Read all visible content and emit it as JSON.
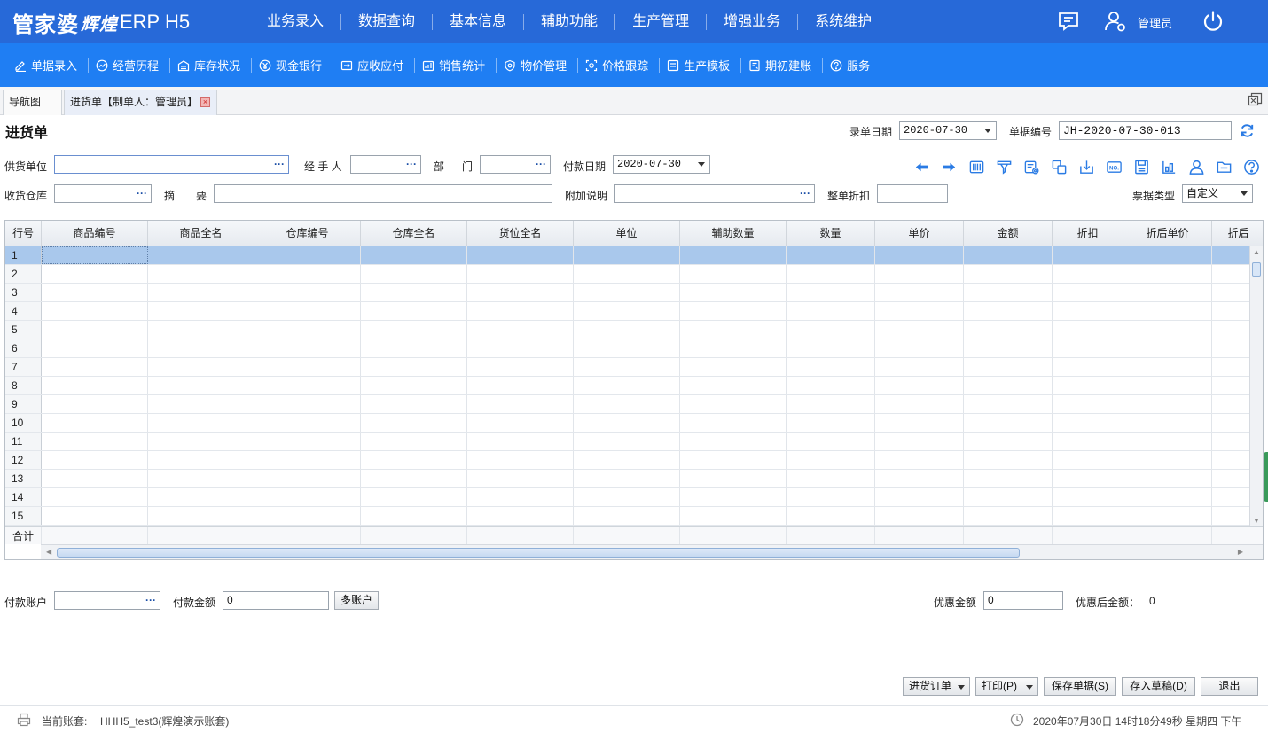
{
  "app": {
    "logo_main": "管家婆",
    "logo_sub": "辉煌",
    "logo_suffix": "ERP H5",
    "user": "管理员"
  },
  "main_menu": [
    "业务录入",
    "数据查询",
    "基本信息",
    "辅助功能",
    "生产管理",
    "增强业务",
    "系统维护"
  ],
  "sub_menu": [
    {
      "label": "单据录入",
      "icon": "edit-icon"
    },
    {
      "label": "经营历程",
      "icon": "chart-circle-icon"
    },
    {
      "label": "库存状况",
      "icon": "warehouse-icon"
    },
    {
      "label": "现金银行",
      "icon": "yuan-icon"
    },
    {
      "label": "应收应付",
      "icon": "receivable-icon"
    },
    {
      "label": "销售统计",
      "icon": "stats-icon"
    },
    {
      "label": "物价管理",
      "icon": "shield-price-icon"
    },
    {
      "label": "价格跟踪",
      "icon": "track-icon"
    },
    {
      "label": "生产模板",
      "icon": "template-icon"
    },
    {
      "label": "期初建账",
      "icon": "ledger-icon"
    },
    {
      "label": "服务",
      "icon": "help-icon"
    }
  ],
  "tabs": {
    "nav": "导航图",
    "active": "进货单【制单人：管理员】",
    "close": "×"
  },
  "form": {
    "title": "进货单",
    "entry_date_label": "录单日期",
    "entry_date": "2020-07-30",
    "doc_no_label": "单据编号",
    "doc_no": "JH-2020-07-30-013",
    "supplier_label": "供货单位",
    "supplier": "",
    "handler_label": "经 手 人",
    "handler": "",
    "dept_label_a": "部",
    "dept_label_b": "门",
    "dept": "",
    "pay_date_label": "付款日期",
    "pay_date": "2020-07-30",
    "warehouse_label": "收货仓库",
    "warehouse": "",
    "summary_label_a": "摘",
    "summary_label_b": "要",
    "summary": "",
    "note_label": "附加说明",
    "note": "",
    "discount_label": "整单折扣",
    "discount": "",
    "invoice_type_label": "票据类型",
    "invoice_type": "自定义",
    "dots": "···"
  },
  "toolbar_icons": [
    "arrow-left-icon",
    "arrow-right-icon",
    "barcode-icon",
    "filter-icon",
    "config-icon",
    "copy-icon",
    "import-icon",
    "number-icon",
    "save-doc-icon",
    "chart-doc-icon",
    "person-icon",
    "folder-icon",
    "help-icon"
  ],
  "grid": {
    "columns": [
      "行号",
      "商品编号",
      "商品全名",
      "仓库编号",
      "仓库全名",
      "货位全名",
      "单位",
      "辅助数量",
      "数量",
      "单价",
      "金额",
      "折扣",
      "折后单价",
      "折后"
    ],
    "rows": [
      "1",
      "2",
      "3",
      "4",
      "5",
      "6",
      "7",
      "8",
      "9",
      "10",
      "11",
      "12",
      "13",
      "14",
      "15"
    ],
    "total_label": "合计"
  },
  "payment": {
    "account_label": "付款账户",
    "account": "",
    "amount_label": "付款金额",
    "amount": "0",
    "multi_account": "多账户",
    "discount_amount_label": "优惠金额",
    "discount_amount": "0",
    "after_discount_label": "优惠后金额：",
    "after_discount": "0"
  },
  "actions": {
    "purchase_order": "进货订单",
    "print": "打印(P)",
    "save": "保存单据(S)",
    "draft": "存入草稿(D)",
    "exit": "退出"
  },
  "status": {
    "account_set_label": "当前账套:",
    "account_set": "HHH5_test3(辉煌演示账套)",
    "datetime": "2020年07月30日 14时18分49秒 星期四 下午"
  },
  "colors": {
    "topbar": "#2769d8",
    "subbar": "#1f7ef3",
    "selected_row": "#a9c8ec",
    "icon_blue": "#2a7be4"
  }
}
